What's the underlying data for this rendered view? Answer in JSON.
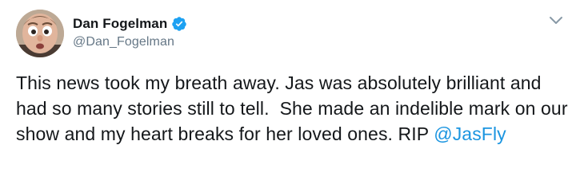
{
  "author": {
    "display_name": "Dan Fogelman",
    "handle": "@Dan_Fogelman",
    "verified": true
  },
  "tweet": {
    "text": "This news took my breath away. Jas was absolutely brilliant and had so many stories still to tell.  She made an indelible mark on our show and my heart breaks for her loved ones. RIP ",
    "mention": "@JasFly"
  },
  "icons": {
    "verified": "verified-badge-icon",
    "caret": "chevron-down-icon"
  },
  "colors": {
    "accent": "#1da1f2",
    "mention": "#1b95e0",
    "handle": "#657786",
    "text": "#14171a"
  }
}
